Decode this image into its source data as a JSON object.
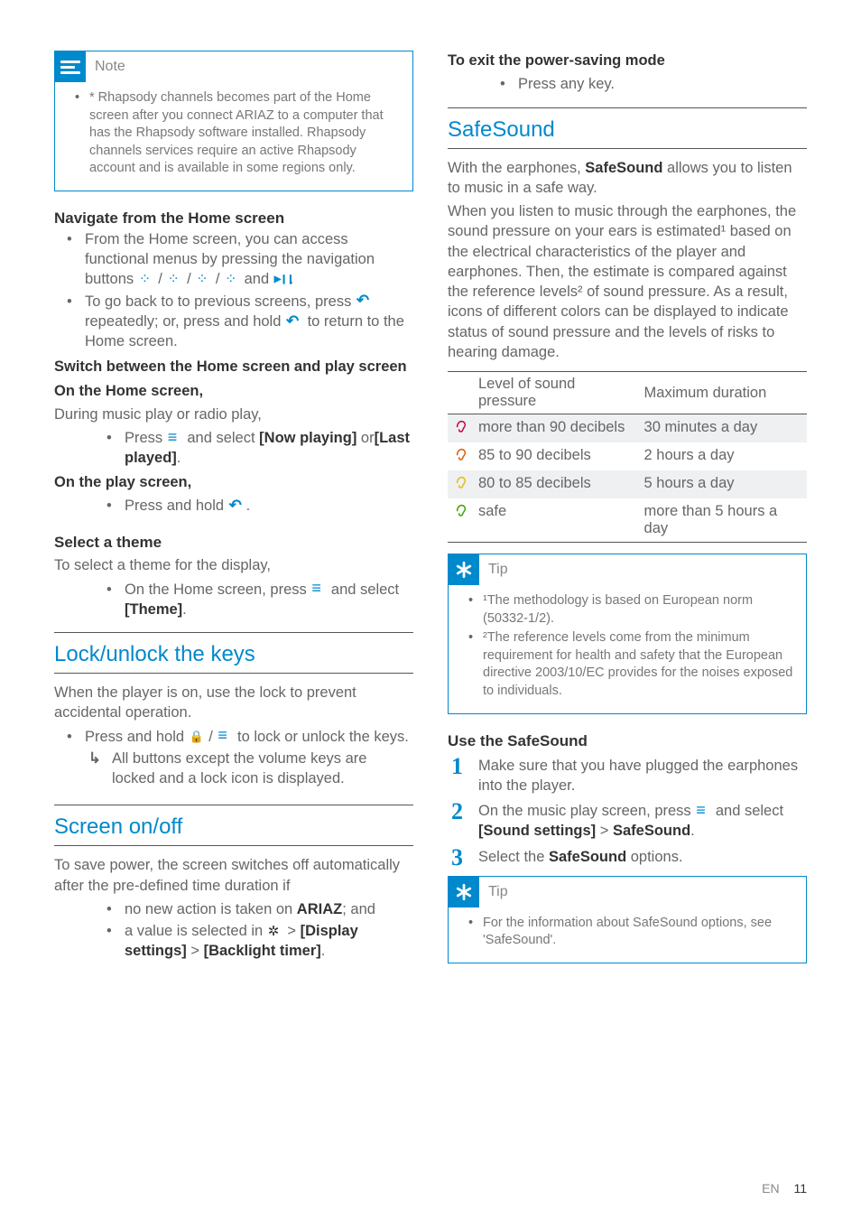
{
  "left": {
    "note": {
      "label": "Note",
      "items": [
        "* Rhapsody channels becomes part of the Home screen after you connect ARIAZ to a computer that has the Rhapsody software installed. Rhapsody channels services require an active Rhapsody account and is available in some regions only."
      ]
    },
    "nav": {
      "title": "Navigate from the Home screen",
      "b1a": "From the Home screen, you can access functional menus by pressing the navigation buttons ",
      "b1b": " and ",
      "b2a": "To go back to to previous screens, press ",
      "b2b": " repeatedly; or, press and hold ",
      "b2c": " to return to the Home screen.",
      "switch_heading": "Switch between the Home screen and play screen",
      "home_label": "On the Home screen,",
      "home_line": "During music play or radio play,",
      "home_sub_a": "Press ",
      "home_sub_b": " and select ",
      "now_playing": "[Now playing]",
      "or": " or",
      "last_played": "[Last played]",
      "play_label": "On the play screen,",
      "play_sub": "Press and hold "
    },
    "theme": {
      "title": "Select a theme",
      "lead": "To select a theme for the display,",
      "sub_a": "On the Home screen, press ",
      "sub_b": " and select ",
      "theme_opt": "[Theme]"
    },
    "lock": {
      "title": "Lock/unlock the keys",
      "lead": "When the player is on, use the lock to prevent accidental operation.",
      "b1a": "Press and hold ",
      "b1b": " to lock or unlock the keys.",
      "arrow": "All buttons except the volume keys are locked and a lock icon is displayed."
    },
    "screen": {
      "title": "Screen on/off",
      "lead": "To save power, the screen switches off automatically after the pre-defined time duration if",
      "b1a": "no new action is taken on ",
      "ariaz": "ARIAZ",
      "b1b": "; and",
      "b2a": "a value is selected in ",
      "disp": "[Display settings]",
      "gt": " > ",
      "bl": "[Backlight timer]"
    }
  },
  "right": {
    "exit_title": "To exit the power-saving mode",
    "exit_item": "Press any key.",
    "safesound": {
      "title": "SafeSound",
      "p1a": "With the earphones, ",
      "p1b": "SafeSound",
      "p1c": " allows you to listen to music in a safe way.",
      "p2": "When you listen to music through the earphones, the sound pressure on your ears is estimated¹ based on the electrical characteristics of the player and earphones. Then, the estimate is compared against the reference levels² of sound pressure. As a result, icons of different colors can be displayed to indicate status of sound pressure and the levels of risks to hearing damage."
    },
    "table": {
      "h1": "Level of sound pressure",
      "h2": "Maximum duration",
      "rows": [
        {
          "level": "more than 90 decibels",
          "dur": "30 minutes a day",
          "color": "#c0004a"
        },
        {
          "level": "85 to 90 decibels",
          "dur": "2 hours a day",
          "color": "#d85a00"
        },
        {
          "level": "80 to 85 decibels",
          "dur": "5 hours a day",
          "color": "#e0c200"
        },
        {
          "level": "safe",
          "dur": "more than 5 hours a day",
          "color": "#3aa000"
        }
      ]
    },
    "tip1": {
      "label": "Tip",
      "items": [
        "¹The methodology is based on European norm (50332-1/2).",
        "²The reference levels come from the minimum requirement for health and safety that the European directive 2003/10/EC provides for the noises exposed to individuals."
      ]
    },
    "use": {
      "title": "Use the SafeSound",
      "s1": "Make sure that you have plugged the earphones into the player.",
      "s2a": "On the music play screen, press ",
      "s2b": " and select ",
      "s2c": "[Sound settings]",
      "s2d": " > ",
      "s2e": "SafeSound",
      "s3a": "Select the ",
      "s3b": "SafeSound",
      "s3c": " options."
    },
    "tip2": {
      "label": "Tip",
      "items": [
        "For the information about SafeSound options, see 'SafeSound'."
      ]
    }
  },
  "footer": {
    "lang": "EN",
    "page": "11"
  },
  "chart_data": {
    "type": "table",
    "title": "SafeSound pressure vs. maximum duration",
    "columns": [
      "Level of sound pressure",
      "Maximum duration"
    ],
    "rows": [
      [
        "more than 90 decibels",
        "30 minutes a day"
      ],
      [
        "85 to 90 decibels",
        "2 hours a day"
      ],
      [
        "80 to 85 decibels",
        "5 hours a day"
      ],
      [
        "safe",
        "more than 5 hours a day"
      ]
    ]
  }
}
